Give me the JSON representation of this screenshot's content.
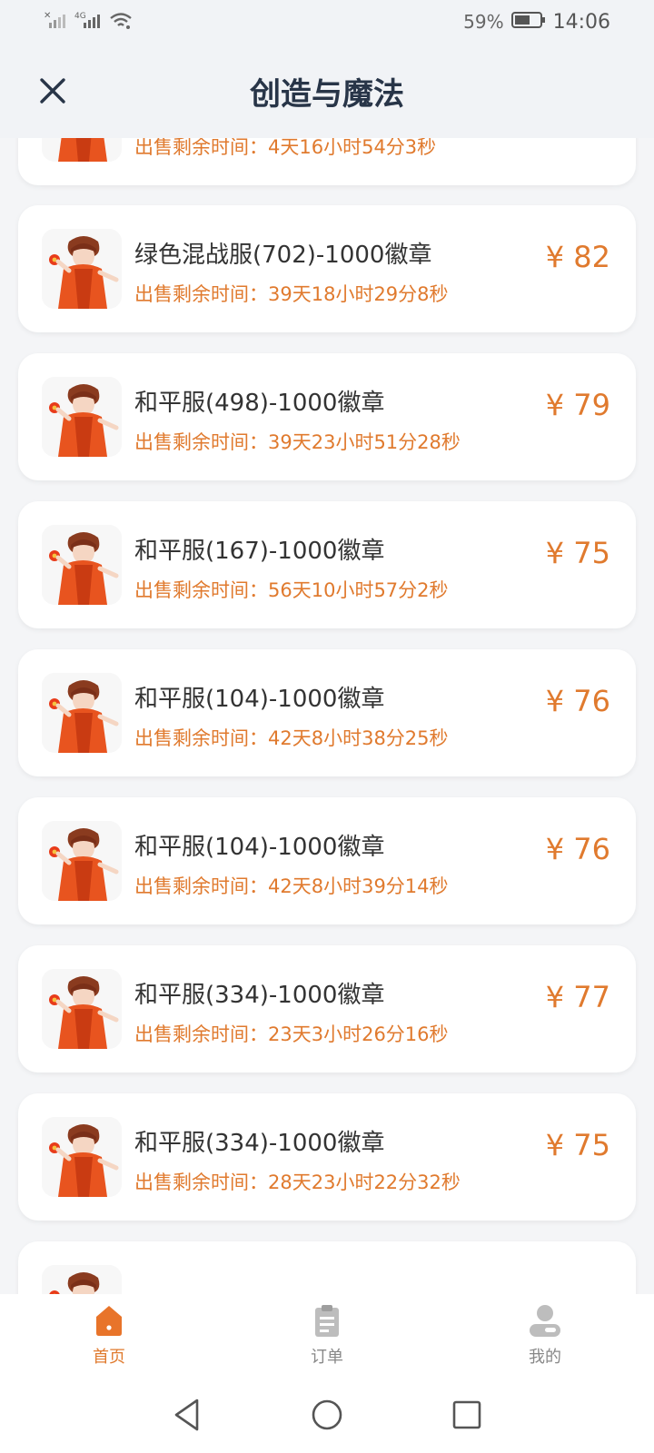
{
  "status_bar": {
    "battery": "59%",
    "time": "14:06",
    "network_label": "4G",
    "icons": [
      "signal-x-icon",
      "signal-4g-icon",
      "wifi-icon",
      "battery-icon"
    ]
  },
  "header": {
    "title": "创造与魔法",
    "close_icon": "close-icon"
  },
  "listings": [
    {
      "name": "",
      "time_label": "出售剩余时间：",
      "time_value": "4天16小时54分3秒",
      "price": ""
    },
    {
      "name": "绿色混战服(702)-1000徽章",
      "time_label": "出售剩余时间：",
      "time_value": "39天18小时29分8秒",
      "price": "¥ 82"
    },
    {
      "name": "和平服(498)-1000徽章",
      "time_label": "出售剩余时间：",
      "time_value": "39天23小时51分28秒",
      "price": "¥ 79"
    },
    {
      "name": "和平服(167)-1000徽章",
      "time_label": "出售剩余时间：",
      "time_value": "56天10小时57分2秒",
      "price": "¥ 75"
    },
    {
      "name": "和平服(104)-1000徽章",
      "time_label": "出售剩余时间：",
      "time_value": "42天8小时38分25秒",
      "price": "¥ 76"
    },
    {
      "name": "和平服(104)-1000徽章",
      "time_label": "出售剩余时间：",
      "time_value": "42天8小时39分14秒",
      "price": "¥ 76"
    },
    {
      "name": "和平服(334)-1000徽章",
      "time_label": "出售剩余时间：",
      "time_value": "23天3小时26分16秒",
      "price": "¥ 77"
    },
    {
      "name": "和平服(334)-1000徽章",
      "time_label": "出售剩余时间：",
      "time_value": "28天23小时22分32秒",
      "price": "¥ 75"
    },
    {
      "name": "",
      "time_label": "",
      "time_value": "",
      "price": ""
    }
  ],
  "tab_bar": {
    "tabs": [
      {
        "label": "首页",
        "icon": "home-icon",
        "active": true
      },
      {
        "label": "订单",
        "icon": "clipboard-icon",
        "active": false
      },
      {
        "label": "我的",
        "icon": "user-icon",
        "active": false
      }
    ]
  },
  "colors": {
    "accent": "#e07a2e",
    "title": "#283548",
    "background": "#f4f5f7"
  }
}
